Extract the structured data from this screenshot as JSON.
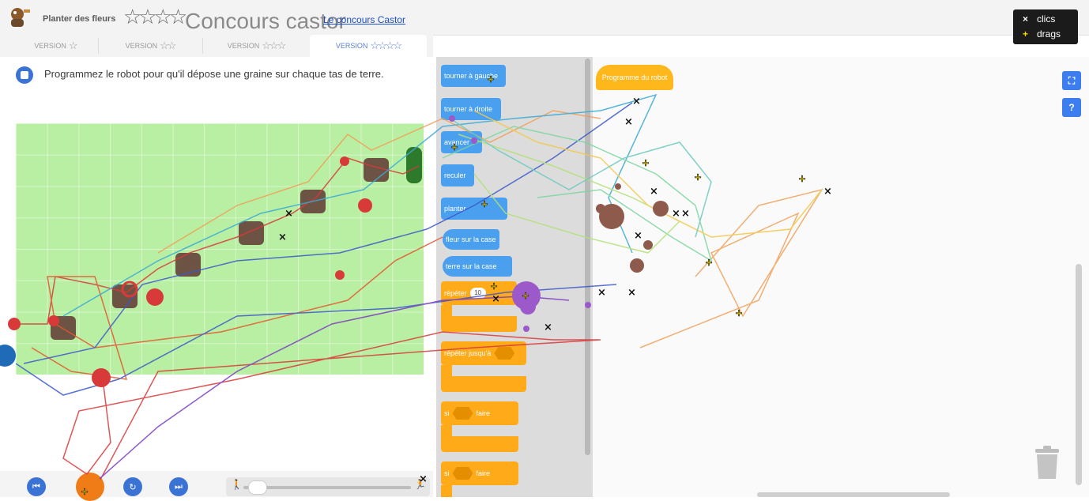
{
  "header": {
    "task_name": "Planter des fleurs",
    "title_stars": "☆☆☆☆",
    "title": "Concours castor",
    "contest_link": "Le concours Castor"
  },
  "tabs": [
    {
      "label": "VERSION",
      "stars": "☆"
    },
    {
      "label": "VERSION",
      "stars": "☆☆"
    },
    {
      "label": "VERSION",
      "stars": "☆☆☆"
    },
    {
      "label": "VERSION",
      "stars": "☆☆☆☆"
    }
  ],
  "active_tab_index": 3,
  "instruction": "Programmez le robot pour qu'il dépose une graine sur chaque tas de terre.",
  "toolbox": {
    "blocks": [
      {
        "label": "tourner à gauche",
        "color": "#4aa0ee"
      },
      {
        "label": "tourner à droite",
        "color": "#4aa0ee"
      },
      {
        "label": "avancer",
        "color": "#4aa0ee"
      },
      {
        "label": "reculer",
        "color": "#4aa0ee"
      },
      {
        "label": "planter",
        "color": "#4aa0ee"
      },
      {
        "label": "fleur sur la case",
        "color": "#4aa0ee"
      },
      {
        "label": "terre sur la case",
        "color": "#4aa0ee"
      },
      {
        "label": "répéter",
        "value": "10",
        "color": "#ffab19"
      },
      {
        "label": "répéter jusqu'à",
        "color": "#ffab19"
      },
      {
        "label": "si",
        "label2": "faire",
        "color": "#ffab19"
      },
      {
        "label": "si",
        "label2": "faire",
        "color": "#ffab19"
      }
    ]
  },
  "workspace": {
    "program_block": "Programme du robot"
  },
  "side_buttons": {
    "fullscreen": "⛶",
    "help": "?"
  },
  "controls": {
    "first": "⏮",
    "play": "▶",
    "step": "↻",
    "last": "⏭"
  },
  "legend": {
    "clicks_symbol": "×",
    "clicks_label": "clics",
    "drags_symbol": "+",
    "drags_label": "drags"
  }
}
